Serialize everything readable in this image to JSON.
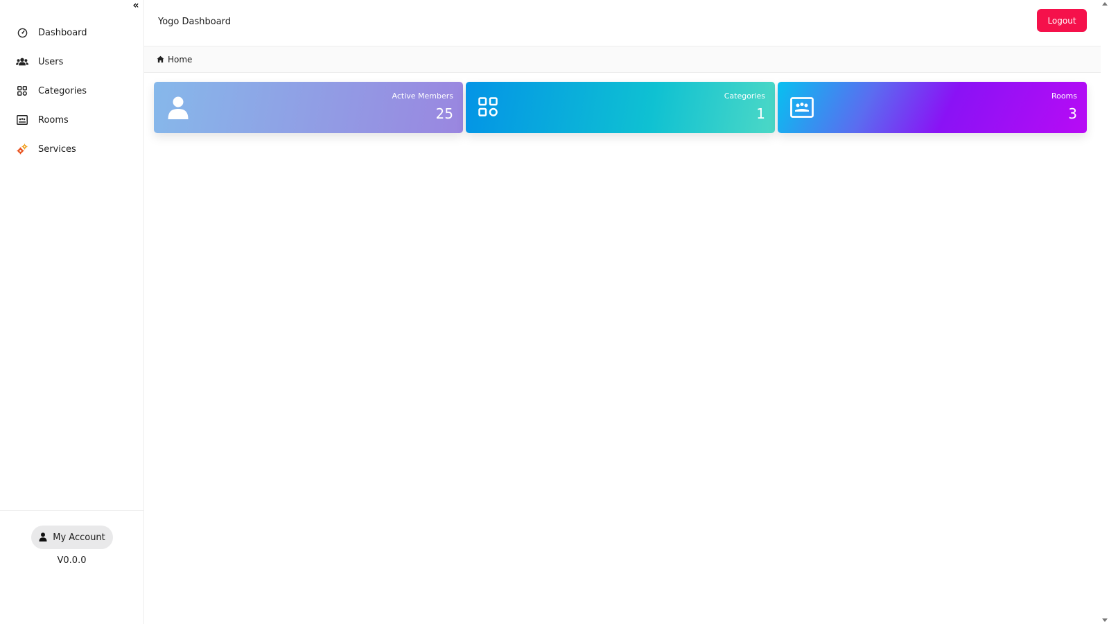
{
  "sidebar": {
    "collapse_glyph": "«",
    "items": [
      {
        "label": "Dashboard",
        "icon": "gauge-icon"
      },
      {
        "label": "Users",
        "icon": "users-icon"
      },
      {
        "label": "Categories",
        "icon": "grid-icon"
      },
      {
        "label": "Rooms",
        "icon": "room-icon"
      },
      {
        "label": "Services",
        "icon": "gears-icon"
      }
    ],
    "account_label": "My Account",
    "version": "V0.0.0"
  },
  "header": {
    "title": "Yogo Dashboard",
    "logout_label": "Logout"
  },
  "breadcrumb": {
    "home_label": "Home"
  },
  "cards": [
    {
      "label": "Active Members",
      "value": "25",
      "icon": "user-icon"
    },
    {
      "label": "Categories",
      "value": "1",
      "icon": "grid-icon"
    },
    {
      "label": "Rooms",
      "value": "3",
      "icon": "room-icon"
    }
  ],
  "colors": {
    "logout": "#f5114b",
    "services_icon": "#e8501c"
  }
}
